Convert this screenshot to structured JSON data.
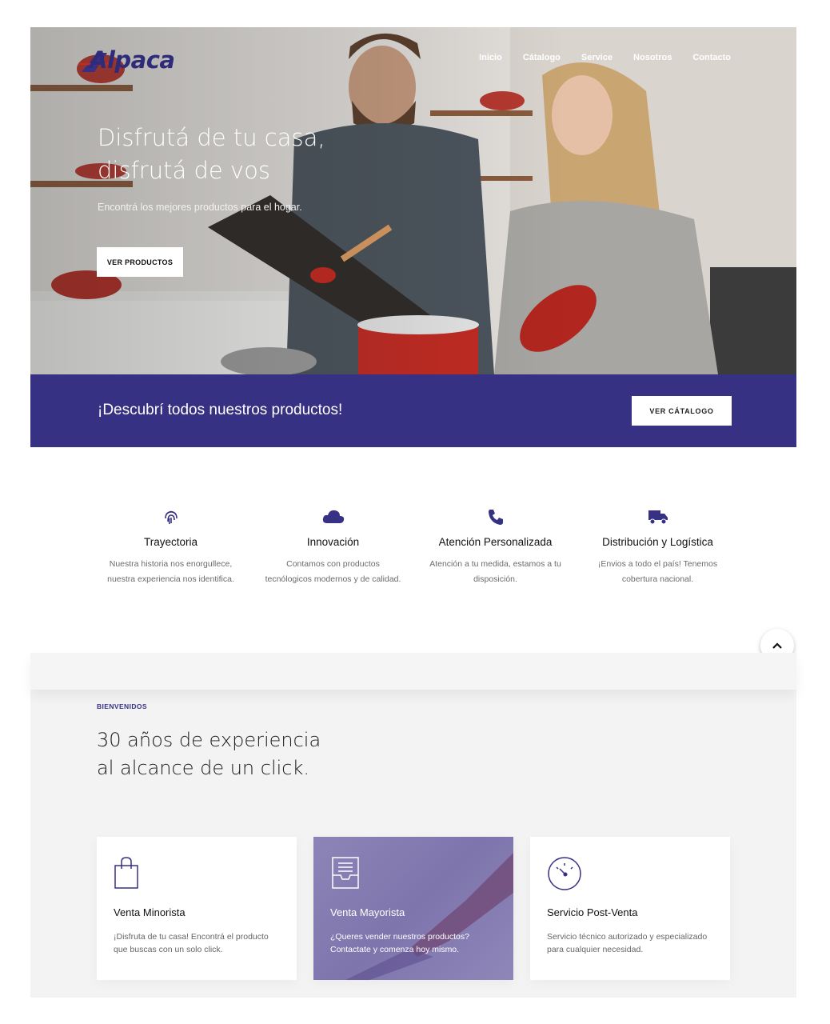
{
  "brand": {
    "name": "Alpaca",
    "color": "#363183"
  },
  "nav": {
    "items": [
      "Inicio",
      "Cátalogo",
      "Service",
      "Nosotros",
      "Contacto"
    ]
  },
  "hero": {
    "title_line1": "Disfrutá de tu casa,",
    "title_line2": "disfrutá de vos",
    "subtitle": "Encontrá los mejores productos para el hogar.",
    "button": "VER PRODUCTOS"
  },
  "band": {
    "text": "¡Descubrí todos nuestros productos!",
    "button": "VER CÁTALOGO",
    "bg": "#363183"
  },
  "features": [
    {
      "icon": "fingerprint-icon",
      "title": "Trayectoria",
      "line1": "Nuestra historia nos enorgullece,",
      "line2": "nuestra experiencia nos identifica."
    },
    {
      "icon": "cloud-icon",
      "title": "Innovación",
      "line1": "Contamos con productos",
      "line2": "tecnólogicos modernos y de calidad."
    },
    {
      "icon": "phone-icon",
      "title": "Atención Personalizada",
      "line1": "Atención a tu medida, estamos a tu",
      "line2": "disposición."
    },
    {
      "icon": "truck-icon",
      "title": "Distribución y Logística",
      "line1": "¡Envios a todo el país! Tenemos",
      "line2": "cobertura nacional."
    }
  ],
  "welcome": {
    "eyebrow": "BIENVENIDOS",
    "title_line1": "30 años de experiencia",
    "title_line2": "al alcance de un click."
  },
  "cards": [
    {
      "icon": "shopping-bag-icon",
      "title": "Venta Minorista",
      "line1": "¡Disfruta de tu casa! Encontrá el producto",
      "line2": "que buscas con un solo click."
    },
    {
      "icon": "inbox-tray-icon",
      "title": "Venta Mayorista",
      "line1": "¿Queres vender nuestros productos?",
      "line2": "Contactate y comenza hoy mismo."
    },
    {
      "icon": "gauge-icon",
      "title": "Servicio Post-Venta",
      "line1": "Servicio técnico autorizado y especializado",
      "line2": "para cualquier necesidad."
    }
  ],
  "scroll_top": {
    "icon": "chevron-up-icon"
  }
}
